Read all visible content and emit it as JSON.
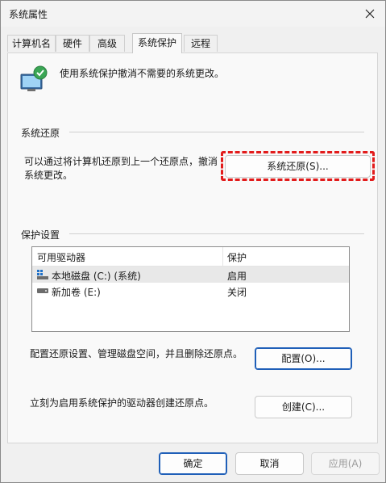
{
  "window": {
    "title": "系统属性"
  },
  "tabs": [
    {
      "label": "计算机名"
    },
    {
      "label": "硬件"
    },
    {
      "label": "高级"
    },
    {
      "label": "系统保护"
    },
    {
      "label": "远程"
    }
  ],
  "header": {
    "text": "使用系统保护撤消不需要的系统更改。"
  },
  "restore": {
    "group_title": "系统还原",
    "desc_line1": "可以通过将计算机还原到上一个还原点，撤消",
    "desc_line2": "系统更改。",
    "button_label": "系统还原(S)..."
  },
  "protection": {
    "group_title": "保护设置",
    "columns": [
      "可用驱动器",
      "保护"
    ],
    "rows": [
      {
        "drive": "本地磁盘 (C:) (系统)",
        "status": "启用"
      },
      {
        "drive": "新加卷 (E:)",
        "status": "关闭"
      }
    ],
    "configure_desc": "配置还原设置、管理磁盘空间，并且删除还原点。",
    "configure_label": "配置(O)...",
    "create_desc": "立刻为启用系统保护的驱动器创建还原点。",
    "create_label": "创建(C)..."
  },
  "footer": {
    "ok_label": "确定",
    "cancel_label": "取消",
    "apply_label": "应用(A)"
  },
  "colors": {
    "highlight": "#e21b1b",
    "primary_border": "#1f5fb8",
    "window_bg": "#f0f0f0"
  },
  "icons": [
    "system-protection-icon",
    "close-icon",
    "system-drive-icon",
    "drive-icon"
  ]
}
